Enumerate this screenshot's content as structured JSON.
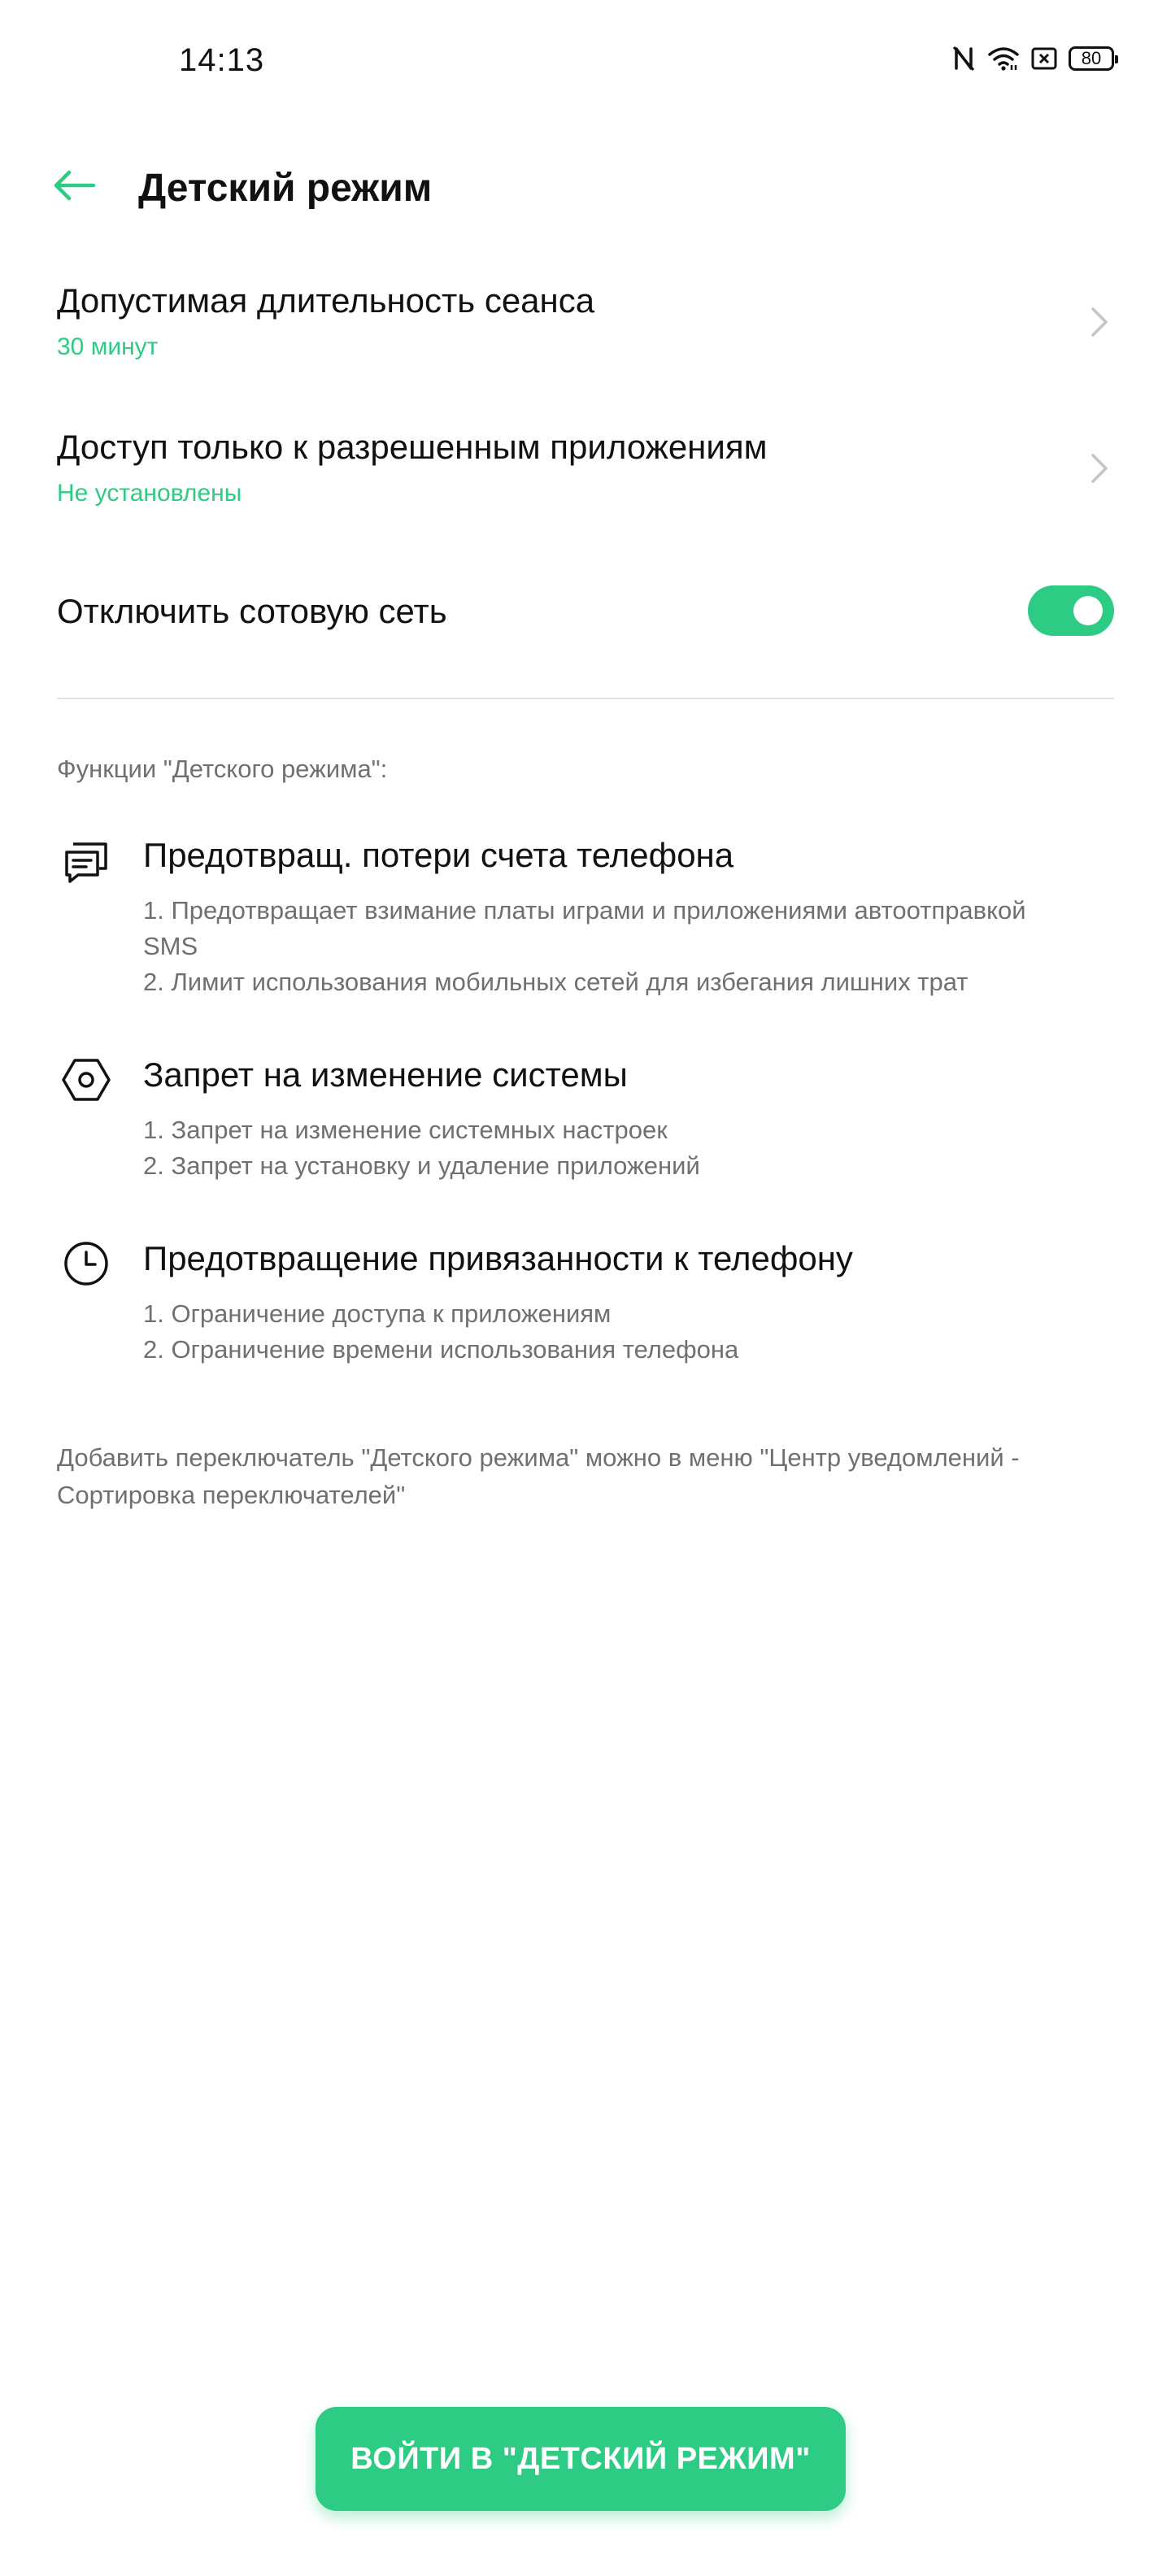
{
  "status_bar": {
    "time": "14:13",
    "battery": "80",
    "icons": [
      "nfc-icon",
      "wifi-icon",
      "sim-icon",
      "battery-icon"
    ]
  },
  "header": {
    "title": "Детский режим",
    "back_icon": "arrow-left-icon"
  },
  "settings": [
    {
      "title": "Допустимая длительность сеанса",
      "value": "30 минут"
    },
    {
      "title": "Доступ только к разрешенным приложениям",
      "value": "Не установлены"
    }
  ],
  "cellular": {
    "label": "Отключить сотовую сеть",
    "enabled": true
  },
  "features_section": {
    "title": "Функции \"Детского режима\":",
    "items": [
      {
        "icon": "message-icon",
        "title": "Предотвращ. потери счета телефона",
        "lines": [
          "1. Предотвращает взимание платы играми и приложениями автоотправкой SMS",
          "2. Лимит использования мобильных сетей для избегания лишних трат"
        ]
      },
      {
        "icon": "hexagon-settings-icon",
        "title": "Запрет на изменение системы",
        "lines": [
          "1. Запрет на изменение системных настроек",
          "2. Запрет на установку и удаление приложений"
        ]
      },
      {
        "icon": "clock-icon",
        "title": "Предотвращение привязанности к телефону",
        "lines": [
          "1. Ограничение доступа к приложениям",
          "2. Ограничение времени использования телефона"
        ]
      }
    ]
  },
  "footer_note": "Добавить переключатель \"Детского режима\" можно в меню \"Центр уведомлений - Сортировка переключателей\"",
  "enter_button": "ВОЙТИ В \"ДЕТСКИЙ РЕЖИМ\"",
  "colors": {
    "accent": "#2ECB85",
    "secondary_text": "#707070"
  }
}
